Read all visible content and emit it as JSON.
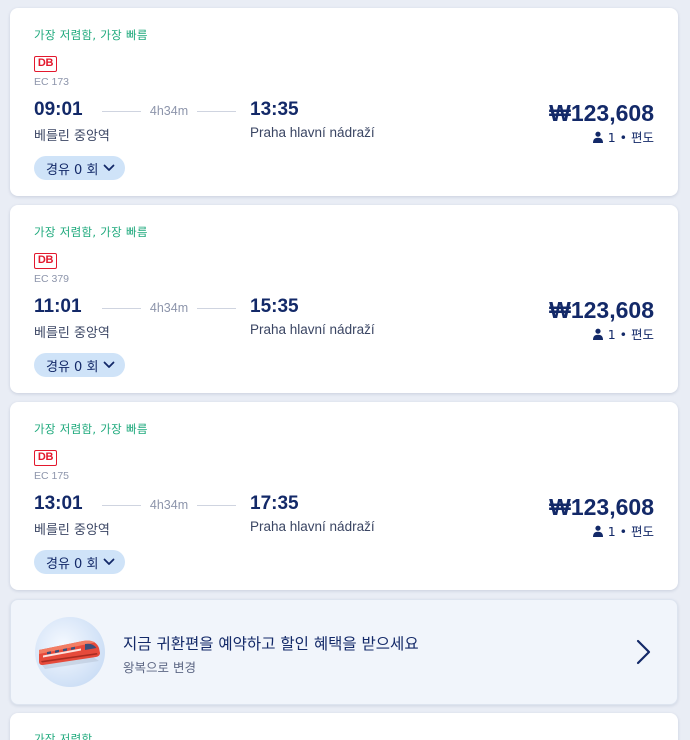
{
  "trips": [
    {
      "tag": "가장 저렴함, 가장 빠름",
      "operator_logo": "DB",
      "train_number": "EC 173",
      "departure_time": "09:01",
      "duration": "4h34m",
      "arrival_time": "13:35",
      "departure_station": "베를린 중앙역",
      "arrival_station": "Praha hlavní nádraží",
      "price": "₩123,608",
      "passengers": "1 • 편도",
      "stops_label": "경유 0 회"
    },
    {
      "tag": "가장 저렴함, 가장 빠름",
      "operator_logo": "DB",
      "train_number": "EC 379",
      "departure_time": "11:01",
      "duration": "4h34m",
      "arrival_time": "15:35",
      "departure_station": "베를린 중앙역",
      "arrival_station": "Praha hlavní nádraží",
      "price": "₩123,608",
      "passengers": "1 • 편도",
      "stops_label": "경유 0 회"
    },
    {
      "tag": "가장 저렴함, 가장 빠름",
      "operator_logo": "DB",
      "train_number": "EC 175",
      "departure_time": "13:01",
      "duration": "4h34m",
      "arrival_time": "17:35",
      "departure_station": "베를린 중앙역",
      "arrival_station": "Praha hlavní nádraží",
      "price": "₩123,608",
      "passengers": "1 • 편도",
      "stops_label": "경유 0 회"
    }
  ],
  "promo": {
    "title": "지금 귀환편을 예약하고 할인 혜택을 받으세요",
    "subtitle": "왕복으로 변경"
  },
  "partial_card": {
    "tag": "가장 저렴함"
  },
  "colors": {
    "navy": "#132968",
    "tag_green": "#1ea97c",
    "db_red": "#e3182d",
    "stops_pill": "#cfe3f8"
  },
  "icons": {
    "passenger": "person-icon",
    "stops_toggle": "chevron-down-icon",
    "promo_arrow": "chevron-right-icon",
    "promo_image": "train-icon"
  }
}
